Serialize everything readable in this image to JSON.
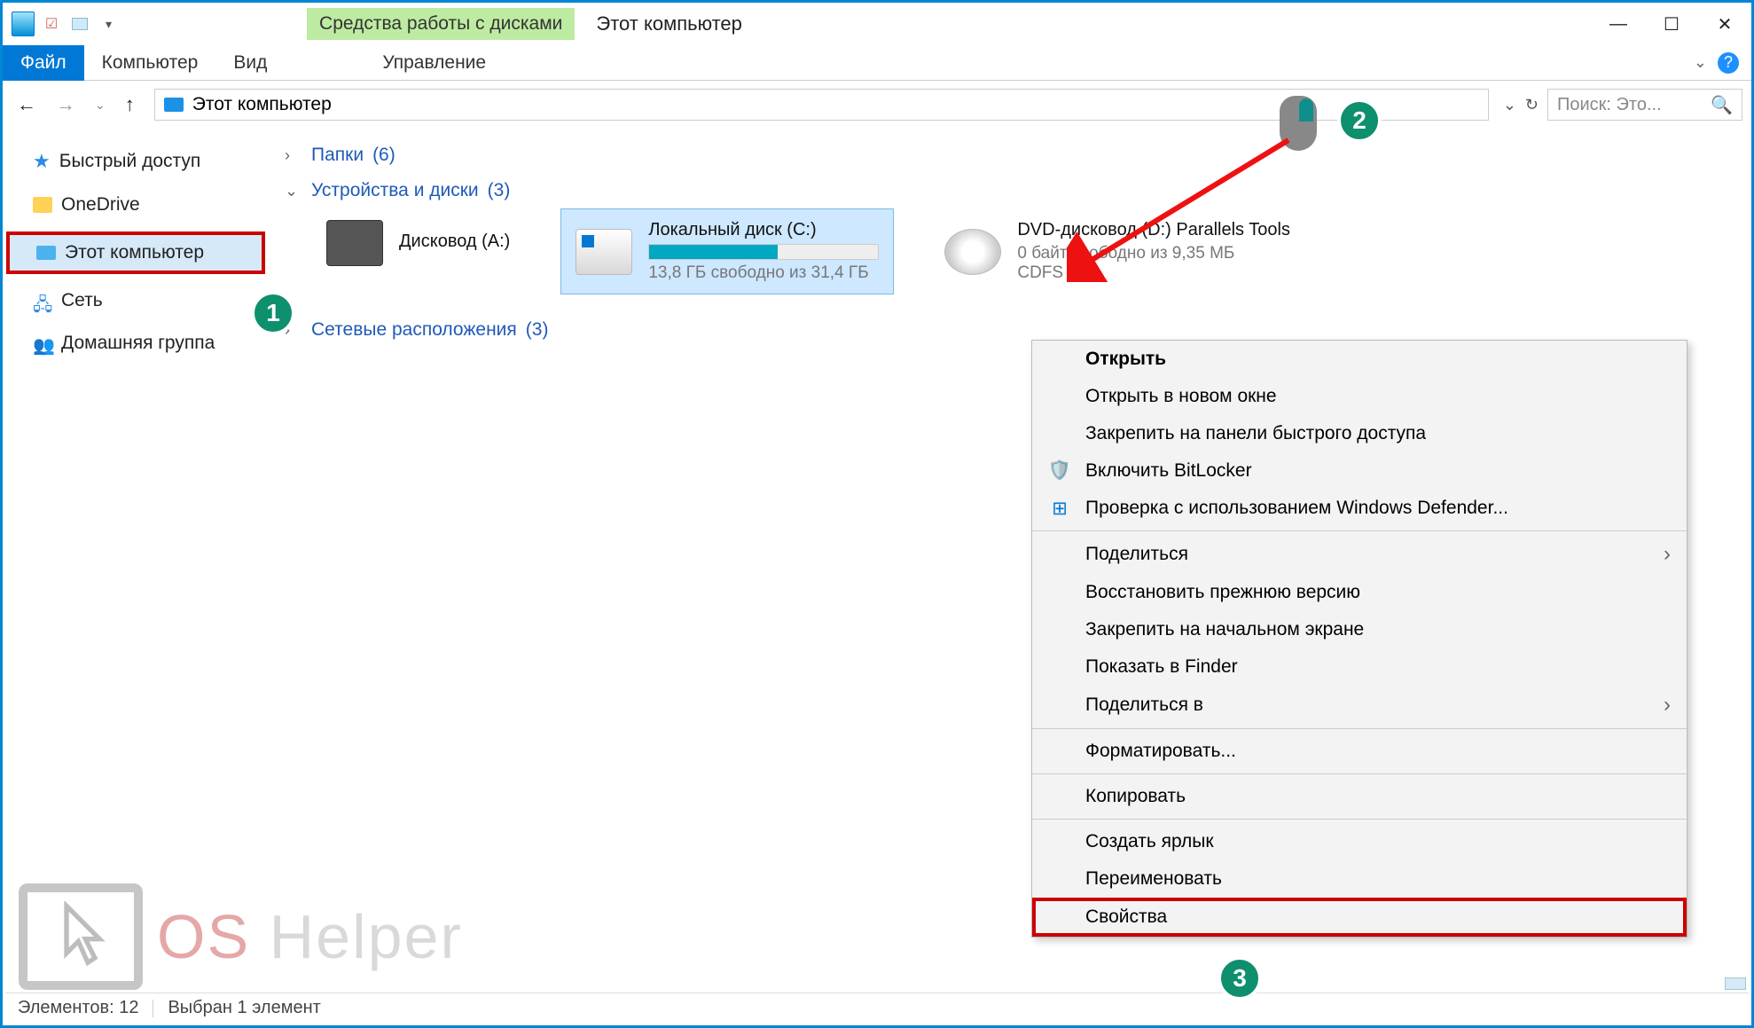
{
  "title": "Этот компьютер",
  "context_tab": "Средства работы с дисками",
  "tabs": {
    "file": "Файл",
    "computer": "Компьютер",
    "view": "Вид",
    "manage": "Управление"
  },
  "address": "Этот компьютер",
  "search_placeholder": "Поиск: Это...",
  "sidebar": {
    "quick": "Быстрый доступ",
    "onedrive": "OneDrive",
    "thispc": "Этот компьютер",
    "network": "Сеть",
    "homegroup": "Домашняя группа"
  },
  "groups": {
    "folders": {
      "label": "Папки",
      "count": "(6)"
    },
    "devices": {
      "label": "Устройства и диски",
      "count": "(3)"
    },
    "network": {
      "label": "Сетевые расположения",
      "count": "(3)"
    }
  },
  "drives": {
    "floppy": {
      "name": "Дисковод (A:)"
    },
    "c": {
      "name": "Локальный диск (C:)",
      "sub": "13,8 ГБ свободно из 31,4 ГБ"
    },
    "dvd": {
      "name": "DVD-дисковод (D:) Parallels Tools",
      "sub": "0 байт свободно из 9,35 МБ",
      "fs": "CDFS"
    }
  },
  "context_menu": {
    "open": "Открыть",
    "open_new": "Открыть в новом окне",
    "pin_quick": "Закрепить на панели быстрого доступа",
    "bitlocker": "Включить BitLocker",
    "defender": "Проверка с использованием Windows Defender...",
    "share": "Поделиться",
    "restore": "Восстановить прежнюю версию",
    "pin_start": "Закрепить на начальном экране",
    "finder": "Показать в Finder",
    "share_in": "Поделиться в",
    "format": "Форматировать...",
    "copy": "Копировать",
    "shortcut": "Создать ярлык",
    "rename": "Переименовать",
    "properties": "Свойства"
  },
  "status": {
    "items": "Элементов: 12",
    "selected": "Выбран 1 элемент"
  },
  "badges": {
    "one": "1",
    "two": "2",
    "three": "3"
  },
  "logo": {
    "os": "OS",
    "helper": " Helper"
  }
}
